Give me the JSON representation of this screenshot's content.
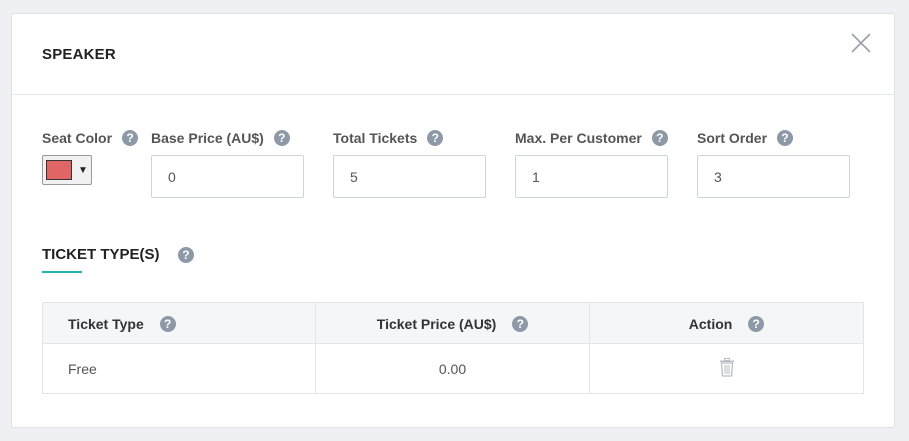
{
  "modal": {
    "title": "SPEAKER"
  },
  "fields": {
    "seat_color": {
      "label": "Seat Color",
      "value": "#e06666"
    },
    "base_price": {
      "label": "Base Price (AU$)",
      "value": "0"
    },
    "total_tickets": {
      "label": "Total Tickets",
      "value": "5"
    },
    "max_per_customer": {
      "label": "Max. Per Customer",
      "value": "1"
    },
    "sort_order": {
      "label": "Sort Order",
      "value": "3"
    }
  },
  "ticket_types": {
    "title": "TICKET TYPE(S)",
    "columns": [
      "Ticket Type",
      "Ticket Price (AU$)",
      "Action"
    ],
    "rows": [
      {
        "type": "Free",
        "price": "0.00"
      }
    ]
  },
  "icons": {
    "help": "help-icon",
    "close": "close-icon",
    "delete": "trash-icon"
  },
  "colors": {
    "accent": "#1fb5ac",
    "help_icon": "#8e99a8"
  }
}
